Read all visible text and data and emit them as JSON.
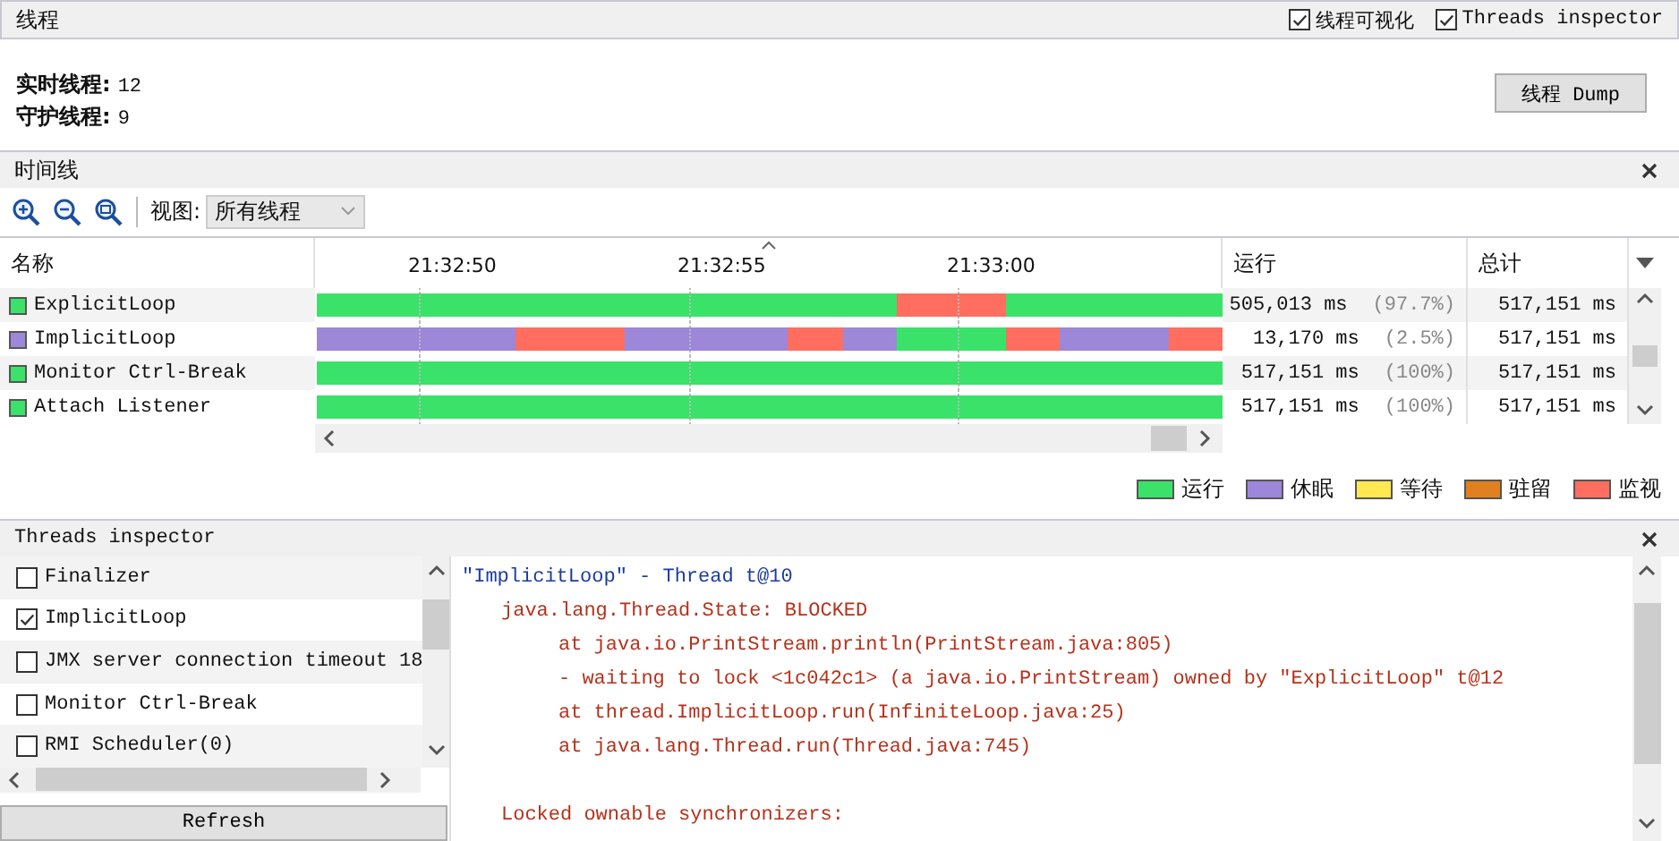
{
  "panel": {
    "title": "线程",
    "options": [
      {
        "label": "线程可视化",
        "checked": true
      },
      {
        "label": "Threads inspector",
        "checked": true
      }
    ]
  },
  "summary": [
    {
      "label": "实时线程:",
      "value": "12"
    },
    {
      "label": "守护线程:",
      "value": "9"
    }
  ],
  "dump_button": "线程 Dump",
  "timeline": {
    "title": "时间线",
    "view_label": "视图:",
    "view_value": "所有线程",
    "columns": [
      "名称",
      "运行",
      "总计"
    ],
    "ticks": [
      "21:32:50",
      "21:32:55",
      "21:33:00"
    ],
    "rows": [
      {
        "name": "ExplicitLoop",
        "color": "#3ae26a",
        "run": "505,013 ms",
        "share": "(97.7%)",
        "total": "517,151 ms",
        "intervals": [
          {
            "kind": "running"
          },
          {
            "kind": "running"
          },
          {
            "kind": "running"
          },
          {
            "kind": "running"
          },
          {
            "kind": "running"
          },
          {
            "kind": "running"
          },
          {
            "kind": "running"
          },
          {
            "kind": "running"
          },
          {
            "kind": "running"
          },
          {
            "kind": "running"
          },
          {
            "kind": "running"
          },
          {
            "kind": "monitor"
          },
          {
            "kind": "monitor"
          },
          {
            "kind": "running"
          },
          {
            "kind": "running"
          },
          {
            "kind": "running"
          },
          {
            "kind": "running"
          }
        ]
      },
      {
        "name": "ImplicitLoop",
        "color": "#9c87d9",
        "run": "13,170 ms",
        "share": "(2.5%)",
        "total": "517,151 ms",
        "intervals": [
          {
            "kind": "sleeping"
          },
          {
            "kind": "sleeping"
          },
          {
            "kind": "sleeping"
          },
          {
            "kind": "sleeping"
          },
          {
            "kind": "monitor"
          },
          {
            "kind": "monitor"
          },
          {
            "kind": "sleeping"
          },
          {
            "kind": "sleeping"
          },
          {
            "kind": "sleeping"
          },
          {
            "kind": "monitor"
          },
          {
            "kind": "sleeping"
          },
          {
            "kind": "running"
          },
          {
            "kind": "running"
          },
          {
            "kind": "monitor"
          },
          {
            "kind": "sleeping"
          },
          {
            "kind": "sleeping"
          },
          {
            "kind": "monitor"
          }
        ]
      },
      {
        "name": "Monitor Ctrl-Break",
        "color": "#3ae26a",
        "run": "517,151 ms",
        "share": "(100%)",
        "total": "517,151 ms",
        "intervals": [
          {
            "kind": "running"
          },
          {
            "kind": "running"
          },
          {
            "kind": "running"
          },
          {
            "kind": "running"
          },
          {
            "kind": "running"
          },
          {
            "kind": "running"
          },
          {
            "kind": "running"
          },
          {
            "kind": "running"
          },
          {
            "kind": "running"
          },
          {
            "kind": "running"
          },
          {
            "kind": "running"
          },
          {
            "kind": "running"
          },
          {
            "kind": "running"
          },
          {
            "kind": "running"
          },
          {
            "kind": "running"
          },
          {
            "kind": "running"
          },
          {
            "kind": "running"
          }
        ]
      },
      {
        "name": "Attach Listener",
        "color": "#3ae26a",
        "run": "517,151 ms",
        "share": "(100%)",
        "total": "517,151 ms",
        "intervals": [
          {
            "kind": "running"
          },
          {
            "kind": "running"
          },
          {
            "kind": "running"
          },
          {
            "kind": "running"
          },
          {
            "kind": "running"
          },
          {
            "kind": "running"
          },
          {
            "kind": "running"
          },
          {
            "kind": "running"
          },
          {
            "kind": "running"
          },
          {
            "kind": "running"
          },
          {
            "kind": "running"
          },
          {
            "kind": "running"
          },
          {
            "kind": "running"
          },
          {
            "kind": "running"
          },
          {
            "kind": "running"
          },
          {
            "kind": "running"
          },
          {
            "kind": "running"
          }
        ]
      }
    ]
  },
  "legend": [
    {
      "kind": "running",
      "label": "运行"
    },
    {
      "kind": "sleeping",
      "label": "休眠"
    },
    {
      "kind": "waiting",
      "label": "等待"
    },
    {
      "kind": "parked",
      "label": "驻留"
    },
    {
      "kind": "monitor",
      "label": "监视"
    }
  ],
  "inspector": {
    "title": "Threads inspector",
    "threads": [
      {
        "name": "Finalizer",
        "checked": false
      },
      {
        "name": "ImplicitLoop",
        "checked": true
      },
      {
        "name": "JMX server connection timeout 18",
        "checked": false
      },
      {
        "name": "Monitor Ctrl-Break",
        "checked": false
      },
      {
        "name": "RMI Scheduler(0)",
        "checked": false
      }
    ],
    "refresh": "Refresh",
    "dump": [
      {
        "kind": "header",
        "text": "\"ImplicitLoop\" - Thread t@10"
      },
      {
        "kind": "state",
        "text": "java.lang.Thread.State: BLOCKED"
      },
      {
        "kind": "frame",
        "text": "at java.io.PrintStream.println(PrintStream.java:805)"
      },
      {
        "kind": "frame",
        "text": "- waiting to lock <1c042c1> (a java.io.PrintStream) owned by \"ExplicitLoop\" t@12"
      },
      {
        "kind": "frame",
        "text": "at thread.ImplicitLoop.run(InfiniteLoop.java:25)"
      },
      {
        "kind": "frame",
        "text": "at java.lang.Thread.run(Thread.java:745)"
      },
      {
        "kind": "section",
        "text": "Locked ownable synchronizers:"
      }
    ]
  }
}
